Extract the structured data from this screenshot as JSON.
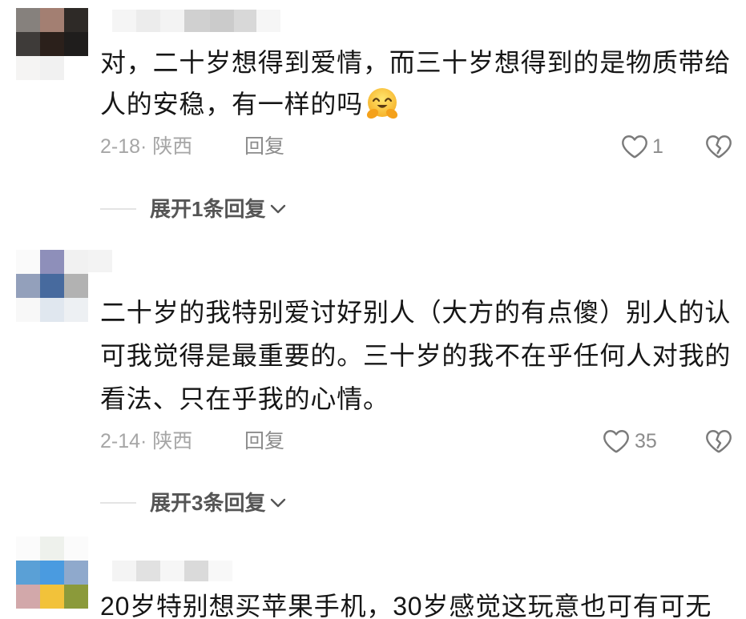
{
  "comments": [
    {
      "text_lines": [
        "对，二十岁想得到爱情，而三十岁想得到的是物质带给",
        "人的安稳，有一样的吗"
      ],
      "emoji_icon": "hugging-face-emoji",
      "date_location": "2-18· 陕西",
      "reply_label": "回复",
      "like_count": "1",
      "expand_replies_label": "展开1条回复"
    },
    {
      "text_lines": [
        "二十岁的我特别爱讨好别人（大方的有点傻）别人的认",
        "可我觉得是最重要的。三十岁的我不在乎任何人对我的",
        "看法、只在乎我的心情。"
      ],
      "date_location": "2-14· 陕西",
      "reply_label": "回复",
      "like_count": "35",
      "expand_replies_label": "展开3条回复"
    },
    {
      "text_lines": [
        "20岁特别想买苹果手机，30岁感觉这玩意也可有可无"
      ]
    }
  ],
  "icons": {
    "like": "heart-outline-icon",
    "dislike": "broken-heart-icon",
    "expand": "chevron-down-icon",
    "avatar": "avatar-mosaic",
    "username": "username-blurred"
  },
  "colors": {
    "background": "#ffffff",
    "text_primary": "#161616",
    "text_meta": "#a6a6a6",
    "text_reply": "#8c8c8c",
    "icon_stroke": "#7a7a7a",
    "expand_text": "#555555",
    "divider": "#e4e4e4"
  }
}
